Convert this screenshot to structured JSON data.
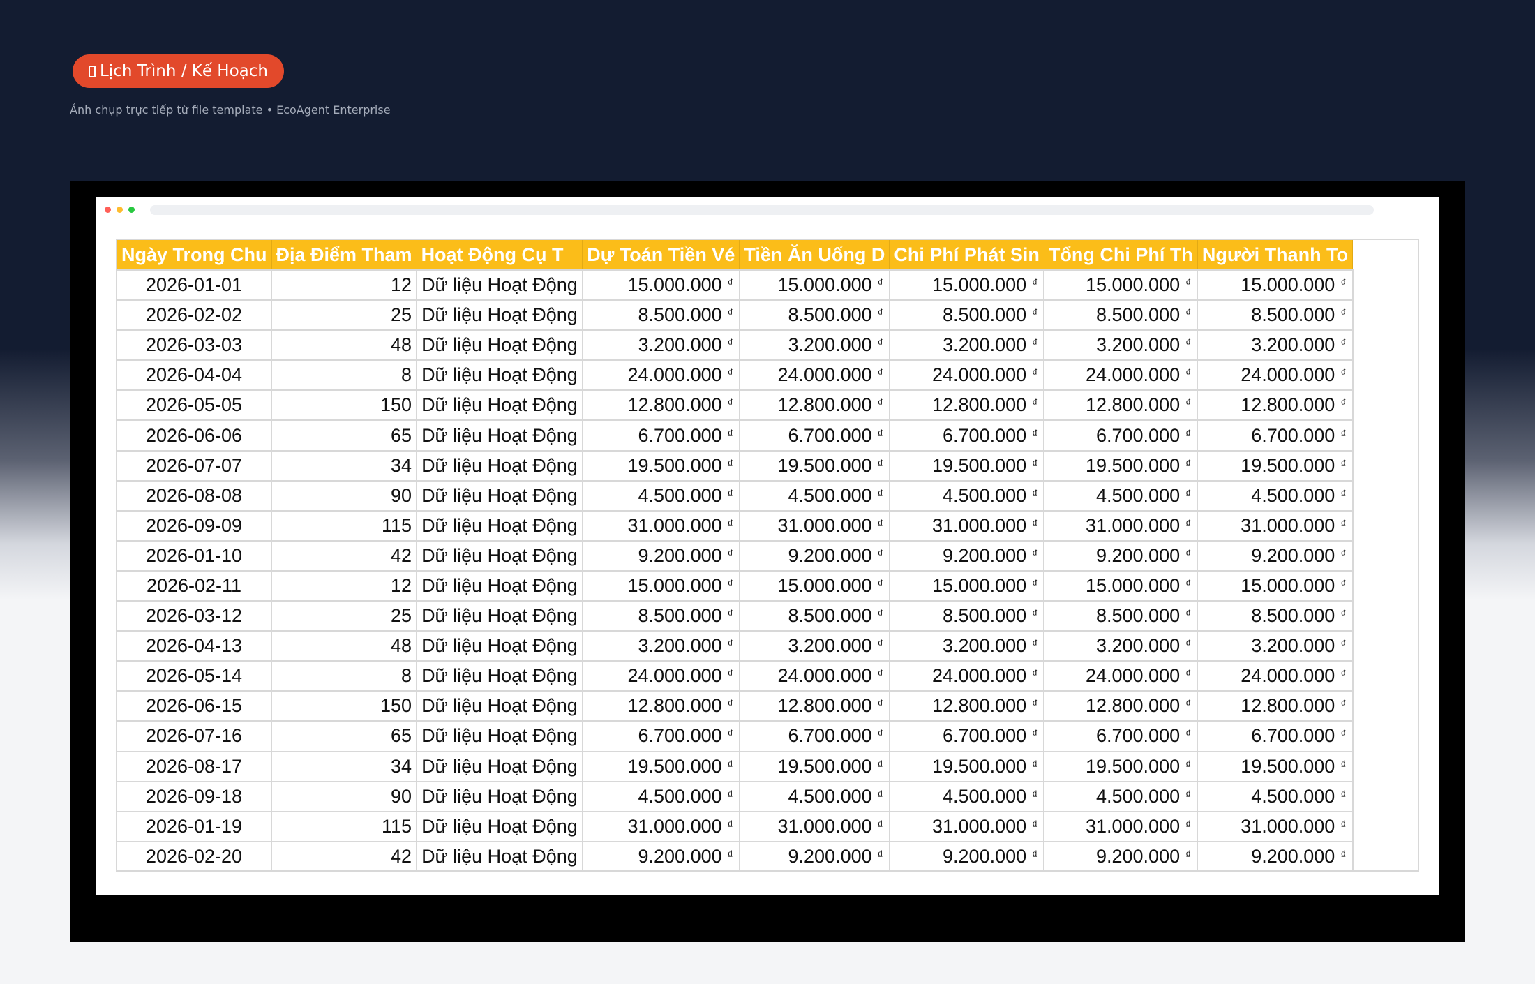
{
  "badge": {
    "icon": "document-icon",
    "label": "Lịch Trình / Kế Hoạch",
    "color": "#e2492b"
  },
  "subtitle": "Ảnh chụp trực tiếp từ file template • EcoAgent Enterprise",
  "window": {
    "dot_colors": [
      "#ff5f57",
      "#febc2e",
      "#28c840"
    ]
  },
  "sheet": {
    "header_color": "#fbbd19",
    "headers": [
      "Ngày Trong Chu",
      "Địa Điểm Tham",
      "Hoạt Động Cụ T",
      "Dự Toán Tiền Vé",
      "Tiền Ăn Uống D",
      "Chi Phí Phát Sin",
      "Tổng Chi Phí Th",
      "Người Thanh To"
    ],
    "currency_symbol": "₫",
    "rows": [
      {
        "date": "2026-01-01",
        "count": "12",
        "activity": "Dữ liệu Hoạt Động",
        "amount": "15.000.000"
      },
      {
        "date": "2026-02-02",
        "count": "25",
        "activity": "Dữ liệu Hoạt Động",
        "amount": "8.500.000"
      },
      {
        "date": "2026-03-03",
        "count": "48",
        "activity": "Dữ liệu Hoạt Động",
        "amount": "3.200.000"
      },
      {
        "date": "2026-04-04",
        "count": "8",
        "activity": "Dữ liệu Hoạt Động",
        "amount": "24.000.000"
      },
      {
        "date": "2026-05-05",
        "count": "150",
        "activity": "Dữ liệu Hoạt Động",
        "amount": "12.800.000"
      },
      {
        "date": "2026-06-06",
        "count": "65",
        "activity": "Dữ liệu Hoạt Động",
        "amount": "6.700.000"
      },
      {
        "date": "2026-07-07",
        "count": "34",
        "activity": "Dữ liệu Hoạt Động",
        "amount": "19.500.000"
      },
      {
        "date": "2026-08-08",
        "count": "90",
        "activity": "Dữ liệu Hoạt Động",
        "amount": "4.500.000"
      },
      {
        "date": "2026-09-09",
        "count": "115",
        "activity": "Dữ liệu Hoạt Động",
        "amount": "31.000.000"
      },
      {
        "date": "2026-01-10",
        "count": "42",
        "activity": "Dữ liệu Hoạt Động",
        "amount": "9.200.000"
      },
      {
        "date": "2026-02-11",
        "count": "12",
        "activity": "Dữ liệu Hoạt Động",
        "amount": "15.000.000"
      },
      {
        "date": "2026-03-12",
        "count": "25",
        "activity": "Dữ liệu Hoạt Động",
        "amount": "8.500.000"
      },
      {
        "date": "2026-04-13",
        "count": "48",
        "activity": "Dữ liệu Hoạt Động",
        "amount": "3.200.000"
      },
      {
        "date": "2026-05-14",
        "count": "8",
        "activity": "Dữ liệu Hoạt Động",
        "amount": "24.000.000"
      },
      {
        "date": "2026-06-15",
        "count": "150",
        "activity": "Dữ liệu Hoạt Động",
        "amount": "12.800.000"
      },
      {
        "date": "2026-07-16",
        "count": "65",
        "activity": "Dữ liệu Hoạt Động",
        "amount": "6.700.000"
      },
      {
        "date": "2026-08-17",
        "count": "34",
        "activity": "Dữ liệu Hoạt Động",
        "amount": "19.500.000"
      },
      {
        "date": "2026-09-18",
        "count": "90",
        "activity": "Dữ liệu Hoạt Động",
        "amount": "4.500.000"
      },
      {
        "date": "2026-01-19",
        "count": "115",
        "activity": "Dữ liệu Hoạt Động",
        "amount": "31.000.000"
      },
      {
        "date": "2026-02-20",
        "count": "42",
        "activity": "Dữ liệu Hoạt Động",
        "amount": "9.200.000"
      }
    ]
  }
}
